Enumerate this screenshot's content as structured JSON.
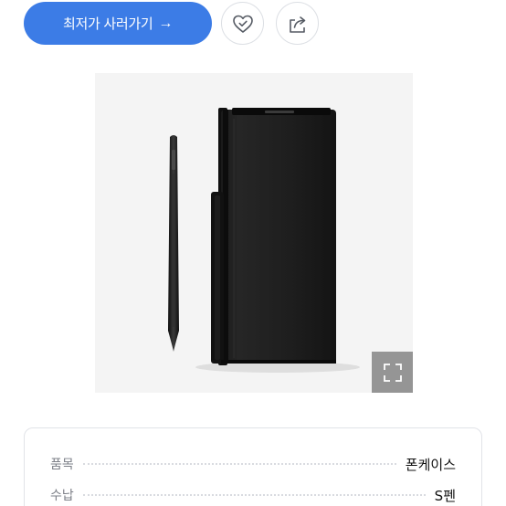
{
  "actions": {
    "buy_label": "최저가 사러가기",
    "buy_arrow": "→",
    "wish_icon": "heart-check-icon",
    "share_icon": "share-icon"
  },
  "product": {
    "image_icon": "phone-case-with-s-pen-image",
    "expand_icon": "expand-icon"
  },
  "specs": [
    {
      "label": "품목",
      "value": "폰케이스"
    },
    {
      "label": "수납",
      "value": "S펜"
    }
  ],
  "colors": {
    "accent": "#3c7ce6",
    "label_gray": "#7d8088",
    "card_border": "#e1e3e8"
  }
}
